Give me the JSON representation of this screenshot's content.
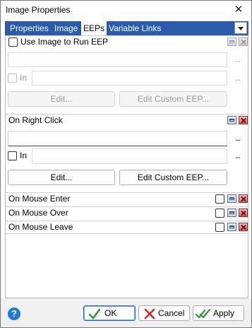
{
  "window": {
    "title": "Image Properties",
    "close_glyph": "✕"
  },
  "tabs": [
    {
      "label": "Properties"
    },
    {
      "label": "Image"
    },
    {
      "label": "EEPs"
    },
    {
      "label": "Variable Links"
    }
  ],
  "eep_sections": {
    "use_image": {
      "label": "Use Image to Run EEP",
      "in_label": "In",
      "ellipsis": "...",
      "edit_label": "Edit...",
      "edit_custom_label": "Edit Custom EEP..."
    },
    "right_click": {
      "label": "On Right Click",
      "in_label": "In",
      "ellipsis": "...",
      "edit_label": "Edit...",
      "edit_custom_label": "Edit Custom EEP..."
    },
    "mouse_enter": {
      "label": "On Mouse Enter"
    },
    "mouse_over": {
      "label": "On Mouse Over"
    },
    "mouse_leave": {
      "label": "On Mouse Leave"
    }
  },
  "footer": {
    "help_glyph": "?",
    "ok_label": "OK",
    "cancel_label": "Cancel",
    "apply_label": "Apply"
  },
  "colors": {
    "tab_strip": "#2a5cab",
    "help": "#1e7ad6",
    "ok_check": "#2e9a2e",
    "cancel_x": "#c62828"
  }
}
